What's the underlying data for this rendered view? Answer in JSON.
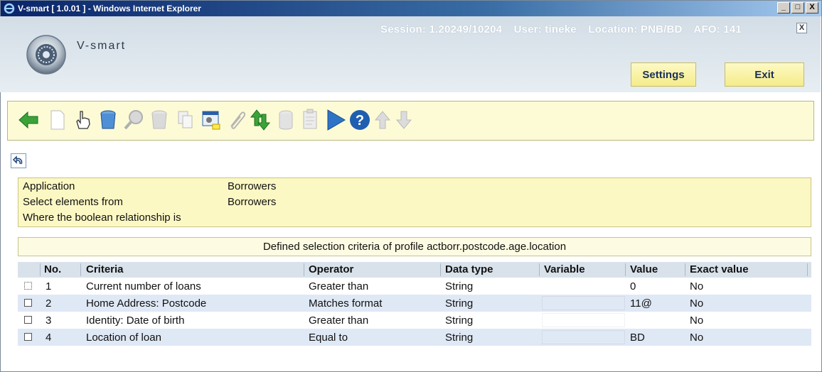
{
  "window": {
    "title": "V-smart [ 1.0.01 ] - Windows Internet Explorer",
    "buttons": [
      "_",
      "□",
      "X"
    ]
  },
  "header": {
    "brand": "V-smart",
    "session": "Session: 1.20249/10204",
    "user": "User: tineke",
    "location": "Location: PNB/BD",
    "afo": "AFO: 141",
    "close": "X",
    "settings_label": "Settings",
    "exit_label": "Exit"
  },
  "toolbar": {
    "icons": [
      "back-arrow-icon",
      "new-document-icon",
      "select-hand-icon",
      "delete-bucket-icon",
      "search-icon",
      "delete-gray-icon",
      "copy-icon",
      "properties-icon",
      "attach-icon",
      "sort-arrows-icon",
      "database-icon",
      "clipboard-icon",
      "play-icon",
      "help-icon",
      "up-arrow-icon",
      "down-arrow-icon"
    ]
  },
  "info": {
    "application_label": "Application",
    "application_value": "Borrowers",
    "select_label": "Select elements from",
    "select_value": "Borrowers",
    "boolean_label": "Where the boolean relationship is",
    "boolean_value": ""
  },
  "caption": "Defined selection criteria of profile actborr.postcode.age.location",
  "table": {
    "columns": [
      "No.",
      "Criteria",
      "Operator",
      "Data type",
      "Variable",
      "Value",
      "Exact value"
    ],
    "rows": [
      {
        "no": "1",
        "criteria": "Current number of loans",
        "operator": "Greater than",
        "datatype": "String",
        "variable": "",
        "value": "0",
        "exact": "No"
      },
      {
        "no": "2",
        "criteria": "Home Address: Postcode",
        "operator": "Matches format",
        "datatype": "String",
        "variable": "",
        "value": "11@",
        "exact": "No"
      },
      {
        "no": "3",
        "criteria": "Identity: Date of birth",
        "operator": "Greater than",
        "datatype": "String",
        "variable": "",
        "value": "",
        "exact": "No"
      },
      {
        "no": "4",
        "criteria": "Location of loan",
        "operator": "Equal to",
        "datatype": "String",
        "variable": "",
        "value": "BD",
        "exact": "No"
      }
    ]
  }
}
